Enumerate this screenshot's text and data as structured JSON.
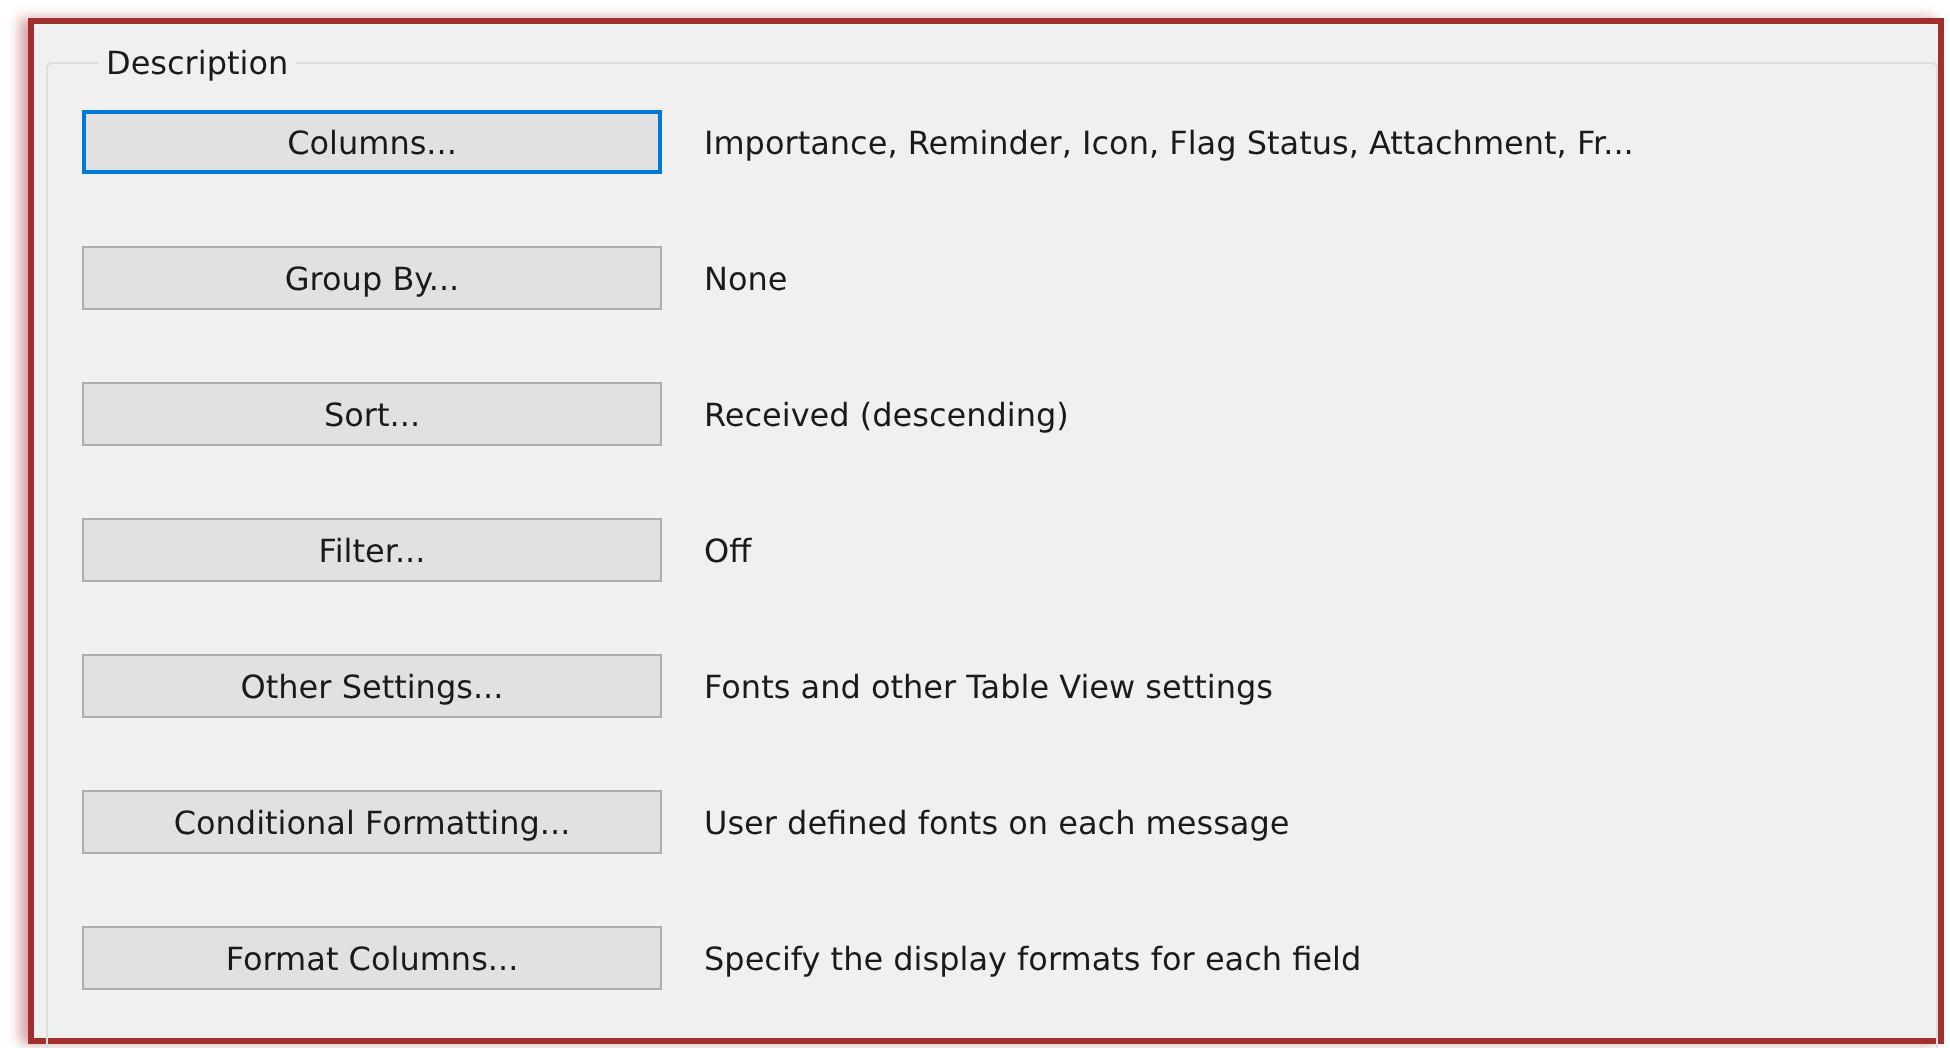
{
  "group_title": "Description",
  "rows": [
    {
      "button": "Columns...",
      "focused": true,
      "description": "Importance, Reminder, Icon, Flag Status, Attachment, Fr..."
    },
    {
      "button": "Group By...",
      "focused": false,
      "description": "None"
    },
    {
      "button": "Sort...",
      "focused": false,
      "description": "Received (descending)"
    },
    {
      "button": "Filter...",
      "focused": false,
      "description": "Off"
    },
    {
      "button": "Other Settings...",
      "focused": false,
      "description": "Fonts and other Table View settings"
    },
    {
      "button": "Conditional Formatting...",
      "focused": false,
      "description": "User defined fonts on each message"
    },
    {
      "button": "Format Columns...",
      "focused": false,
      "description": "Specify the display formats for each field"
    }
  ]
}
